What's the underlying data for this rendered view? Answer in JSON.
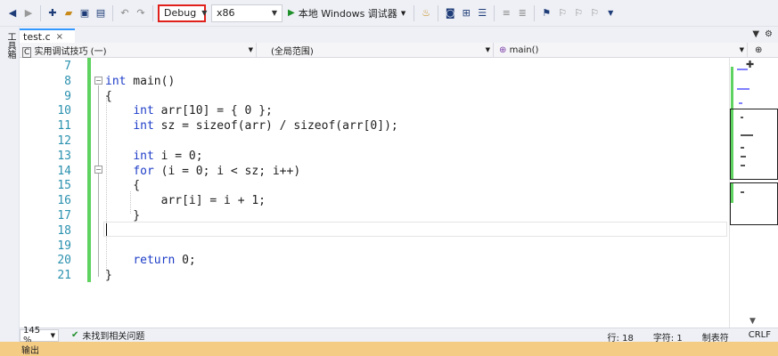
{
  "toolbar": {
    "config": "Debug",
    "platform": "x86",
    "run_label": "本地 Windows 调试器",
    "icons": [
      "back-icon",
      "forward-icon",
      "new-project-icon",
      "open-icon",
      "save-icon",
      "save-all-icon",
      "undo-icon",
      "redo-icon",
      "hot-reload-icon",
      "screenshot-icon",
      "step-icon",
      "comment-icon",
      "uncomment-icon",
      "bookmark-icon",
      "bookmark-prev-icon",
      "bookmark-next-icon",
      "bookmark-clear-icon"
    ]
  },
  "left_strip": {
    "label": "工具箱"
  },
  "tab": {
    "name": "test.c",
    "close": "×"
  },
  "nav": {
    "project": "实用调试技巧",
    "project_suffix": "(一)",
    "scope": "(全局范围)",
    "member": "main()"
  },
  "editor": {
    "line_numbers": [
      "7",
      "8",
      "9",
      "10",
      "11",
      "12",
      "13",
      "14",
      "15",
      "16",
      "17",
      "18",
      "19",
      "20",
      "21"
    ],
    "lines": [
      {
        "t": ""
      },
      {
        "kw": "int",
        "rest": " main()"
      },
      {
        "t": "{"
      },
      {
        "kw": "int",
        "rest": " arr[10] = { 0 };",
        "indent": "    "
      },
      {
        "kw": "int",
        "rest": " sz = sizeof(arr) / sizeof(arr[0]);",
        "indent": "    "
      },
      {
        "t": ""
      },
      {
        "kw": "int",
        "rest": " i = 0;",
        "indent": "    "
      },
      {
        "kw": "for",
        "rest": " (i = 0; i < sz; i++)",
        "indent": "    "
      },
      {
        "t": "    {"
      },
      {
        "t": "        arr[i] = i + 1;"
      },
      {
        "t": "    }"
      },
      {
        "t": ""
      },
      {
        "t": ""
      },
      {
        "kw": "return",
        "rest": " 0;",
        "indent": "    "
      },
      {
        "t": "}"
      }
    ]
  },
  "status": {
    "zoom": "145 %",
    "issues": "未找到相关问题",
    "line": "行: 18",
    "char": "字符: 1",
    "tab_mode": "制表符",
    "eol": "CRLF"
  },
  "output": {
    "title": "输出"
  }
}
